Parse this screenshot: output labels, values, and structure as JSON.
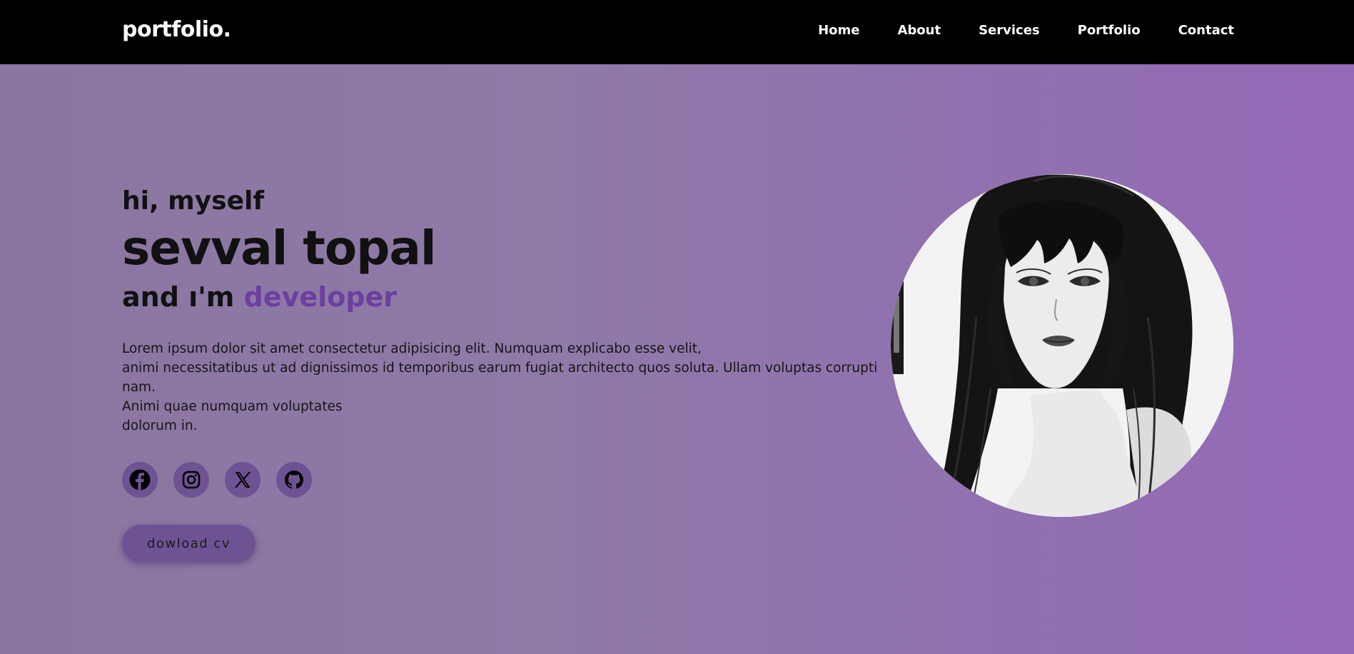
{
  "nav": {
    "logo": "portfolio.",
    "links": [
      "Home",
      "About",
      "Services",
      "Portfolio",
      "Contact"
    ]
  },
  "hero": {
    "greeting": "hi, myself",
    "name": "sevval topal",
    "role_prefix": "and ı'm",
    "role_accent": "developer",
    "bio_lines": [
      "Lorem ipsum dolor sit amet consectetur adipisicing elit. Numquam explicabo esse velit,",
      "animi necessitatibus ut ad dignissimos id temporibus earum fugiat architecto quos soluta. Ullam voluptas corrupti nam.",
      "Animi quae numquam voluptates",
      "dolorum in."
    ],
    "socials": [
      "facebook-icon",
      "instagram-icon",
      "x-icon",
      "github-icon"
    ],
    "cv_button": "dowload cv"
  },
  "colors": {
    "nav_bg": "#000000",
    "accent": "#6c3fa0",
    "button_bg": "#6e5394",
    "bg_start": "#8a76a0",
    "bg_end": "#9469b8"
  }
}
